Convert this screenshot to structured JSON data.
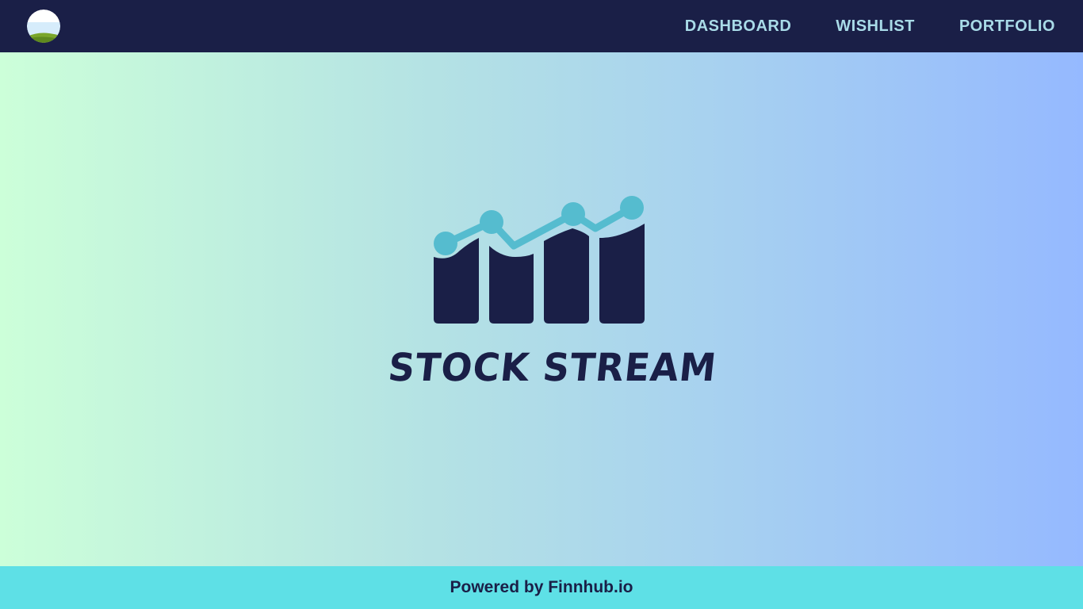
{
  "navbar": {
    "logo_icon": "landscape-avatar-icon",
    "links": [
      {
        "label": "DASHBOARD"
      },
      {
        "label": "WISHLIST"
      },
      {
        "label": "PORTFOLIO"
      }
    ]
  },
  "hero": {
    "logo_icon": "rising-bar-chart-icon",
    "brand_name": "STOCK STREAM"
  },
  "footer": {
    "text": "Powered by Finnhub.io"
  },
  "colors": {
    "navbar_bg": "#1a1f47",
    "nav_link": "#a9dbe8",
    "footer_bg": "#5ee0e6",
    "brand_dark": "#1a1f47",
    "brand_accent": "#55bccf",
    "gradient_start": "#ccffd9",
    "gradient_end": "#95b9ff"
  }
}
